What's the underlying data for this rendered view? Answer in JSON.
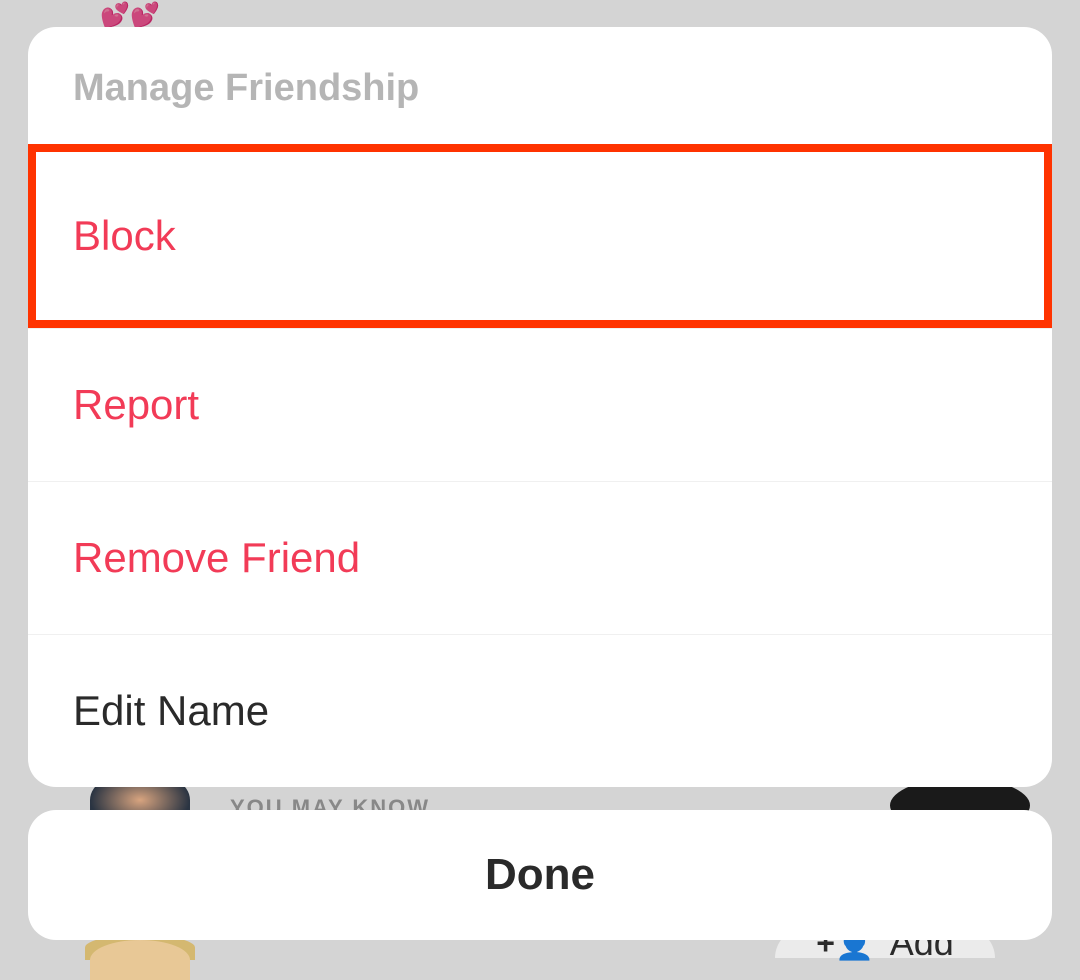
{
  "sheet": {
    "title": "Manage Friendship",
    "options": [
      {
        "label": "Block",
        "style": "destructive",
        "highlighted": true
      },
      {
        "label": "Report",
        "style": "destructive",
        "highlighted": false
      },
      {
        "label": "Remove Friend",
        "style": "destructive",
        "highlighted": false
      },
      {
        "label": "Edit Name",
        "style": "normal",
        "highlighted": false
      }
    ],
    "done_label": "Done"
  },
  "background": {
    "you_may_know": "YOU MAY KNOW",
    "add_label": "Add",
    "hearts": "💕💕"
  },
  "colors": {
    "destructive": "#f23b57",
    "highlight_border": "#ff3300",
    "muted_text": "#b5b5b5"
  }
}
